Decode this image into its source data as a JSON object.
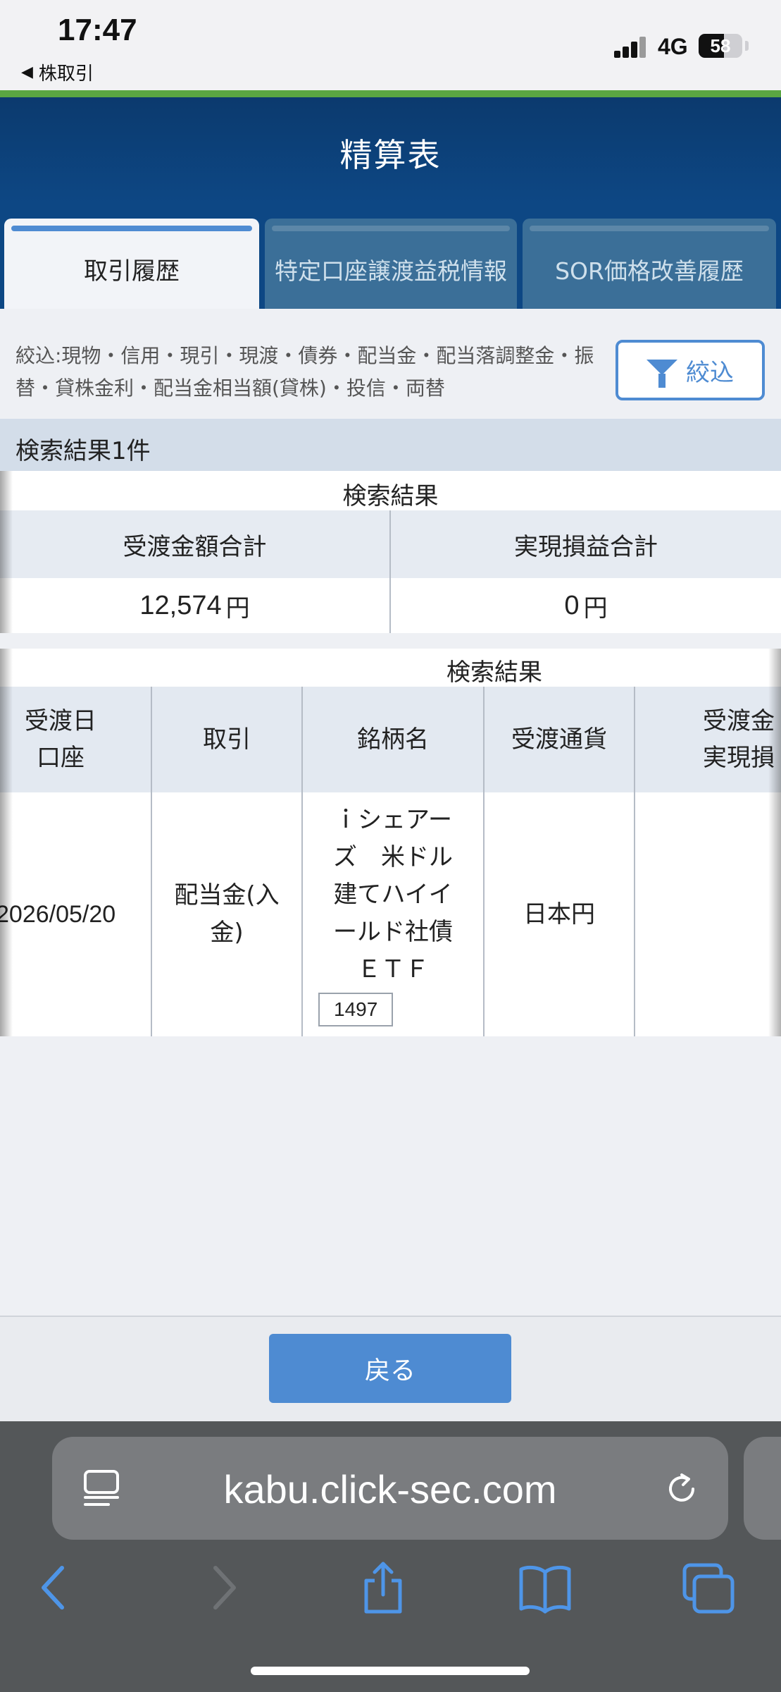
{
  "status": {
    "time": "17:47",
    "back_app": "株取引",
    "network": "4G",
    "battery": "58",
    "battery_level": 0.58
  },
  "header": {
    "title": "精算表"
  },
  "tabs": [
    {
      "label": "取引履歴",
      "active": true
    },
    {
      "label": "特定口座譲渡益税情報",
      "active": false
    },
    {
      "label": "SOR価格改善履歴",
      "active": false
    }
  ],
  "filter": {
    "text": "絞込:現物・信用・現引・現渡・債券・配当金・配当落調整金・振替・貸株金利・配当金相当額(貸株)・投信・両替",
    "button_label": "絞込"
  },
  "result_count": "検索結果1件",
  "summary": {
    "caption": "検索結果",
    "headers": [
      "受渡金額合計",
      "実現損益合計"
    ],
    "values": [
      "12,574",
      "0"
    ],
    "unit": "円"
  },
  "detail": {
    "caption": "検索結果",
    "headers": [
      "受渡日\n口座",
      "取引",
      "銘柄名",
      "受渡通貨",
      "受渡金\n実現損"
    ],
    "row": {
      "date": "2026/05/20",
      "trade": "配当金(入\n金)",
      "name": "ｉシェアー\nズ　米ドル\n建てハイイ\nールド社債\nＥＴＦ",
      "code": "1497",
      "currency": "日本円",
      "amount": ""
    }
  },
  "footer": {
    "back_label": "戻る"
  },
  "browser": {
    "url": "kabu.click-sec.com"
  }
}
